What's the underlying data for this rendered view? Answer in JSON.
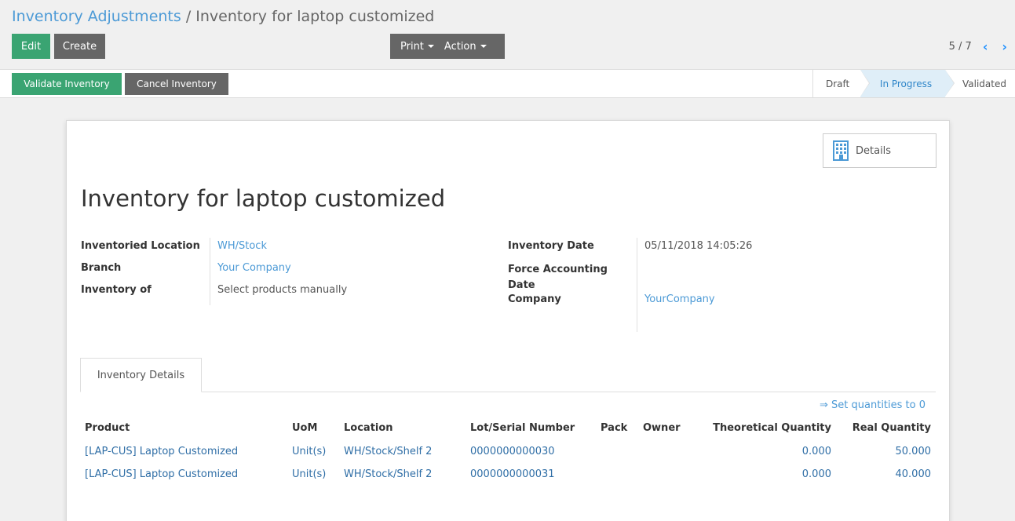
{
  "breadcrumb": {
    "parent": "Inventory Adjustments",
    "separator": "/",
    "current": "Inventory for laptop customized"
  },
  "toolbar": {
    "edit": "Edit",
    "create": "Create",
    "print": "Print",
    "action": "Action"
  },
  "pager": {
    "value": "5 / 7",
    "prev": "‹",
    "next": "›"
  },
  "status_actions": {
    "validate": "Validate Inventory",
    "cancel": "Cancel Inventory"
  },
  "stages": [
    {
      "label": "Draft",
      "active": false
    },
    {
      "label": "In Progress",
      "active": true
    },
    {
      "label": "Validated",
      "active": false
    }
  ],
  "smart_button": {
    "label": "Details",
    "icon": "building-icon"
  },
  "record": {
    "title": "Inventory for laptop customized",
    "left_fields": [
      {
        "label": "Inventoried Location",
        "value": "WH/Stock",
        "link": true
      },
      {
        "label": "Branch",
        "value": "Your Company",
        "link": true
      },
      {
        "label": "Inventory of",
        "value": "Select products manually",
        "link": false
      }
    ],
    "right_fields": [
      {
        "label": "Inventory Date",
        "value": "05/11/2018 14:05:26",
        "link": false
      },
      {
        "label": "Force Accounting Date",
        "value": "",
        "link": false
      },
      {
        "label": "Company",
        "value": "YourCompany",
        "link": true
      }
    ]
  },
  "tab": {
    "label": "Inventory Details"
  },
  "set_quantities": "⇒ Set quantities to 0",
  "table": {
    "headers": {
      "product": "Product",
      "uom": "UoM",
      "location": "Location",
      "lot": "Lot/Serial Number",
      "pack": "Pack",
      "owner": "Owner",
      "theoretical": "Theoretical Quantity",
      "real": "Real Quantity"
    },
    "rows": [
      {
        "product": "[LAP-CUS] Laptop Customized",
        "uom": "Unit(s)",
        "location": "WH/Stock/Shelf 2",
        "lot": "0000000000030",
        "pack": "",
        "owner": "",
        "theoretical": "0.000",
        "real": "50.000"
      },
      {
        "product": "[LAP-CUS] Laptop Customized",
        "uom": "Unit(s)",
        "location": "WH/Stock/Shelf 2",
        "lot": "0000000000031",
        "pack": "",
        "owner": "",
        "theoretical": "0.000",
        "real": "40.000"
      }
    ]
  },
  "colors": {
    "primary_green": "#3aa472",
    "grey_button": "#666666",
    "link_blue": "#4c9ad6",
    "active_stage": "#dfeef8"
  }
}
